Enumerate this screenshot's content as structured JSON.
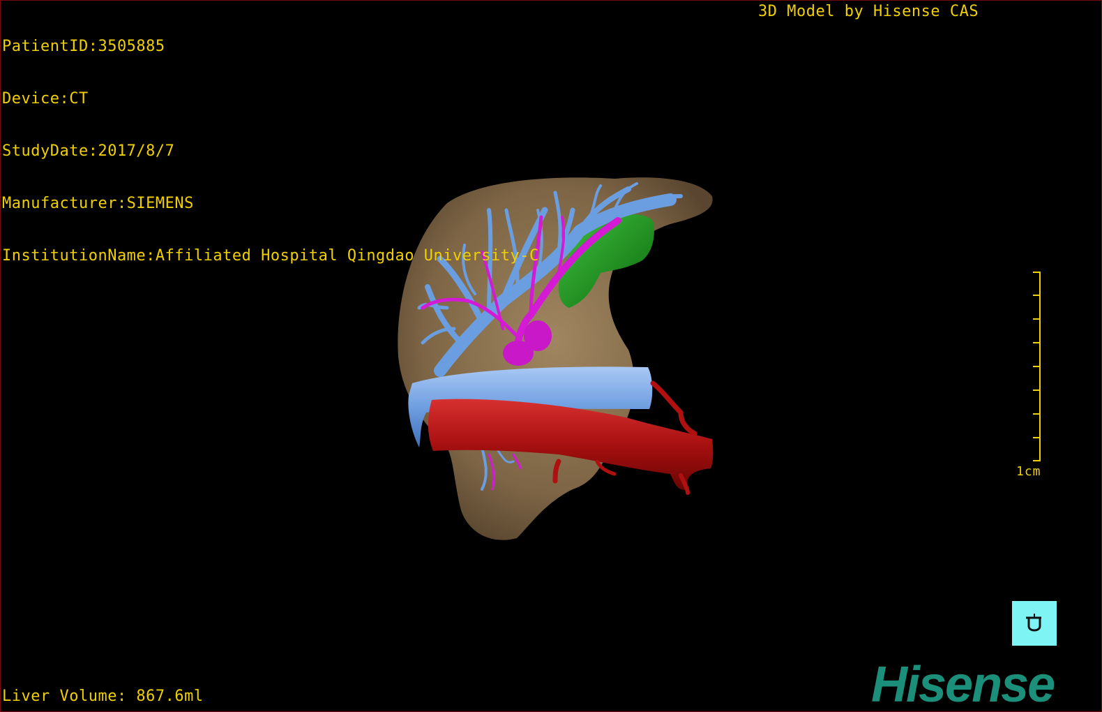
{
  "patient": {
    "id_line": "PatientID:3505885",
    "device_line": "Device:CT",
    "study_date_line": "StudyDate:2017/8/7",
    "manufacturer_line": "Manufacturer:SIEMENS",
    "institution_line": "InstitutionName:Affiliated Hospital Qingdao University-C"
  },
  "credit": "3D Model by Hisense CAS",
  "liver_volume": "Liver Volume: 867.6ml",
  "scale": {
    "label": "1cm"
  },
  "logo": "Hisense",
  "colors": {
    "hud_text": "#f0d000",
    "liver": "#8a7250",
    "portal_vein": "#5b8fd6",
    "hepatic_artery": "#d020d0",
    "vena_cava": "#7aa8e8",
    "aorta": "#b01010",
    "gallbladder": "#1a9a1a",
    "orient_button": "#7ff4f4",
    "logo": "#1b8f7a"
  },
  "icons": {
    "orientation": "orientation-cube-icon"
  }
}
